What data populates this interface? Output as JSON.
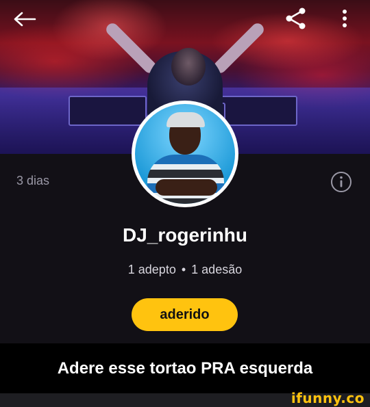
{
  "profile": {
    "username": "DJ_rogerinhu",
    "time_ago": "3 dias",
    "followers": "1 adepto",
    "separator": "•",
    "following": "1 adesão",
    "follow_button": "aderido"
  },
  "icons": {
    "back": "arrow-left-icon",
    "share": "share-icon",
    "menu": "more-vertical-icon",
    "info": "info-icon"
  },
  "caption": "Adere esse tortao PRA esquerda",
  "watermark": "ifunny.co",
  "colors": {
    "accent": "#ffc30f",
    "background": "#121016",
    "caption_bg": "#000000"
  }
}
